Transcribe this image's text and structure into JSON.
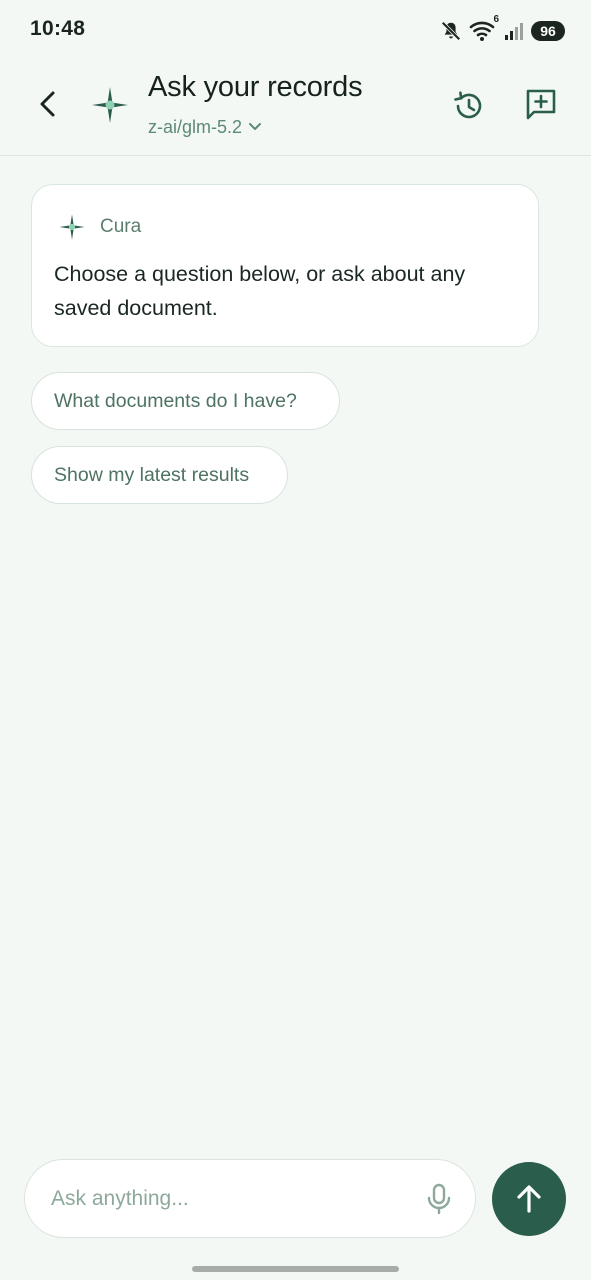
{
  "status_bar": {
    "time": "10:48",
    "wifi_badge": "6",
    "battery_level": "96",
    "icons": [
      "mute-icon",
      "wifi-icon",
      "signal-icon",
      "battery-icon"
    ]
  },
  "header": {
    "title": "Ask your records",
    "model": "z-ai/glm-5.2",
    "icons": [
      "back-arrow-icon",
      "sparkle-logo-icon",
      "chevron-down-icon",
      "history-icon",
      "new-chat-icon"
    ]
  },
  "conversation": {
    "messages": [
      {
        "sender": "Cura",
        "text": "Choose a question below, or ask about any saved document."
      }
    ],
    "suggestions": [
      "What documents do I have?",
      "Show my latest results"
    ]
  },
  "composer": {
    "placeholder": "Ask anything...",
    "icons": [
      "microphone-icon",
      "send-arrow-icon"
    ]
  },
  "colors": {
    "background": "#f3f8f4",
    "accent": "#2b5d4c",
    "muted_green": "#5d8a74",
    "card": "#ffffff"
  }
}
